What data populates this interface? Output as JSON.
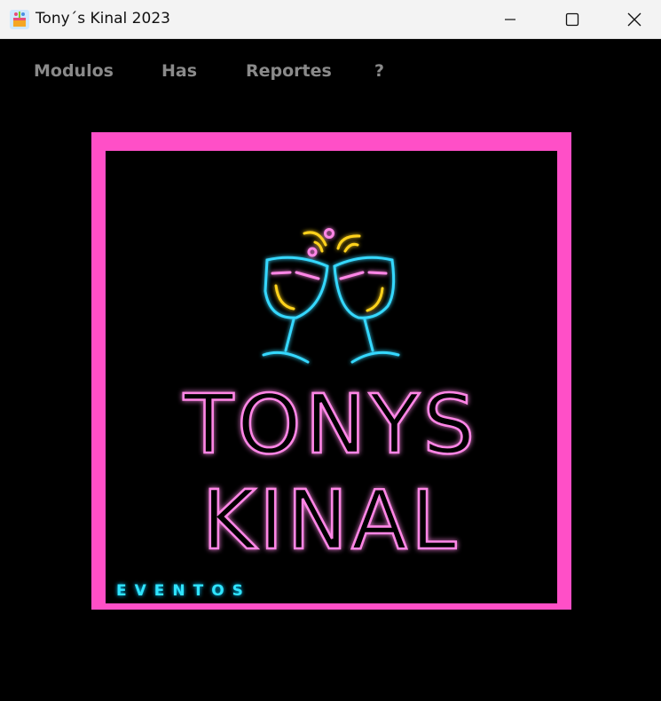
{
  "window": {
    "title": "Tony´s Kinal 2023",
    "icon": "app-party-icon"
  },
  "controls": {
    "minimize_icon": "minimize-icon",
    "maximize_icon": "maximize-icon",
    "close_icon": "close-icon"
  },
  "menu": {
    "items": [
      {
        "label": "Modulos"
      },
      {
        "label": "Has"
      },
      {
        "label": "Reportes"
      },
      {
        "label": "?"
      }
    ]
  },
  "logo": {
    "line1": "TONYS",
    "line2": "KINAL",
    "tagline": "EVENTOS",
    "icon": "clinking-glasses-icon"
  },
  "colors": {
    "frame": "#ff4fc7",
    "neon_pink": "#ff86e6",
    "neon_cyan": "#30e4ff",
    "neon_yellow": "#ffd21a",
    "menu_text": "#8a8a8a"
  }
}
